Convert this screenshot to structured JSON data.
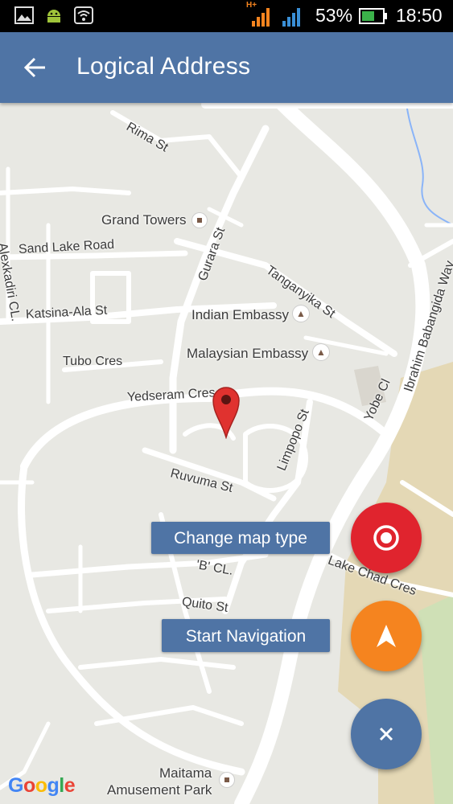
{
  "status_bar": {
    "network_type": "H+",
    "battery_percent": "53%",
    "time": "18:50"
  },
  "app_bar": {
    "title": "Logical Address"
  },
  "map": {
    "labels": {
      "rima_st": "Rima St",
      "grand_towers": "Grand Towers",
      "sand_lake_road": "Sand Lake Road",
      "alexkadiri_cl": "Alexkadiri CL.",
      "gurara_st": "Gurara St",
      "tanganyika_st": "Tanganyika St",
      "katsina_ala_st": "Katsina-Ala St",
      "indian_embassy": "Indian Embassy",
      "ibrahim_babangida_way": "Ibrahim Babangida Way",
      "malaysian_embassy": "Malaysian Embassy",
      "tubo_cres": "Tubo Cres",
      "yobe_cl": "Yobe Cl",
      "yedseram_cres": "Yedseram Cres",
      "limpopo_st": "Limpopo St",
      "ruvuma_st": "Ruvuma St",
      "b_cl": "'B' CL.",
      "lake_chad_cres": "Lake Chad Cres",
      "quito_st": "Quito St",
      "maitama": "Maitama",
      "amusement_park": "Amusement Park"
    },
    "google_logo": [
      "G",
      "o",
      "o",
      "g",
      "l",
      "e"
    ],
    "logo_colors": [
      "#4285f4",
      "#ea4335",
      "#fbbc05",
      "#4285f4",
      "#34a853",
      "#ea4335"
    ]
  },
  "buttons": {
    "change_map_type": "Change map type",
    "start_navigation": "Start Navigation"
  },
  "fabs": [
    {
      "name": "my-location",
      "color": "#e0242e",
      "icon": "target-icon"
    },
    {
      "name": "navigate",
      "color": "#f5841f",
      "icon": "navigation-arrow-icon"
    },
    {
      "name": "close",
      "color": "#4f74a5",
      "icon": "close-icon"
    }
  ],
  "colors": {
    "app_bar": "#4f74a5",
    "map_background": "#e8e8e3",
    "road": "#ffffff",
    "park": "#e4d8b5",
    "marker": "#e0322f"
  }
}
